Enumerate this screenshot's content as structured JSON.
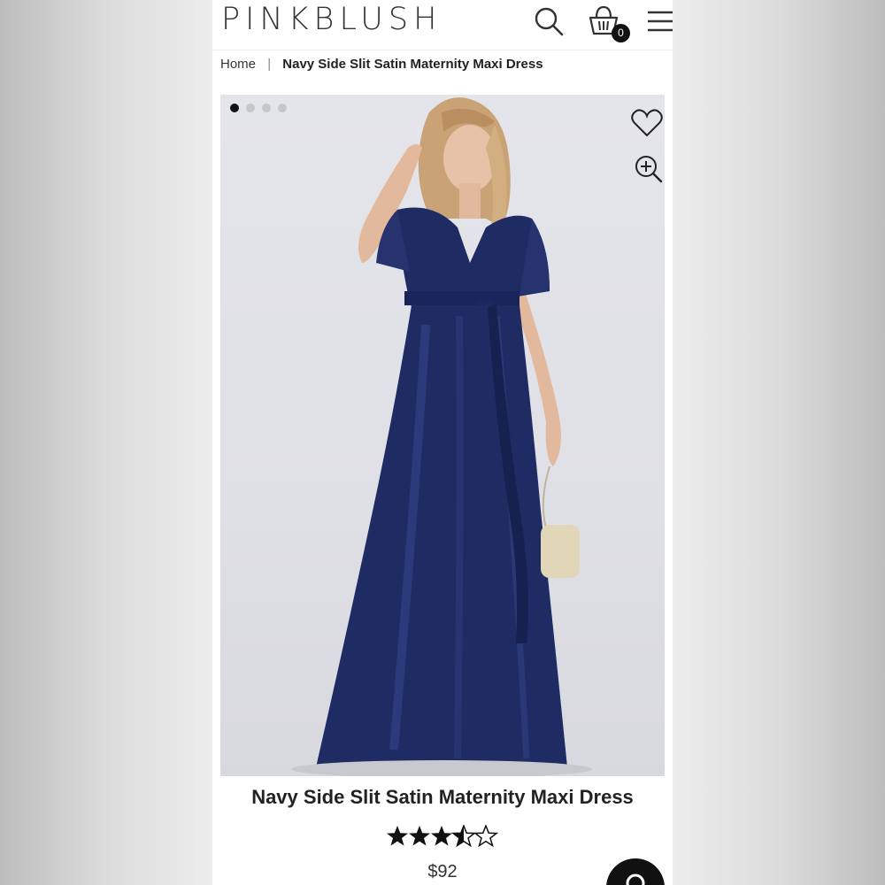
{
  "header": {
    "logo": "PINKBLUSH",
    "cart_count": "0",
    "icons": [
      "search-icon",
      "shopping-bag-icon",
      "hamburger-menu-icon"
    ]
  },
  "breadcrumb": {
    "home": "Home",
    "separator": "|",
    "current": "Navy Side Slit Satin Maternity Maxi Dress"
  },
  "gallery": {
    "image_count": 4,
    "active_index": 0,
    "icons": [
      "heart-icon",
      "zoom-in-icon"
    ],
    "dress_color": "#1f2b63"
  },
  "product": {
    "title": "Navy Side Slit Satin Maternity Maxi Dress",
    "rating_stars": 3.5,
    "rating_max": 5,
    "price": "$92"
  },
  "colors": {
    "text": "#222222",
    "badge": "#111111"
  }
}
